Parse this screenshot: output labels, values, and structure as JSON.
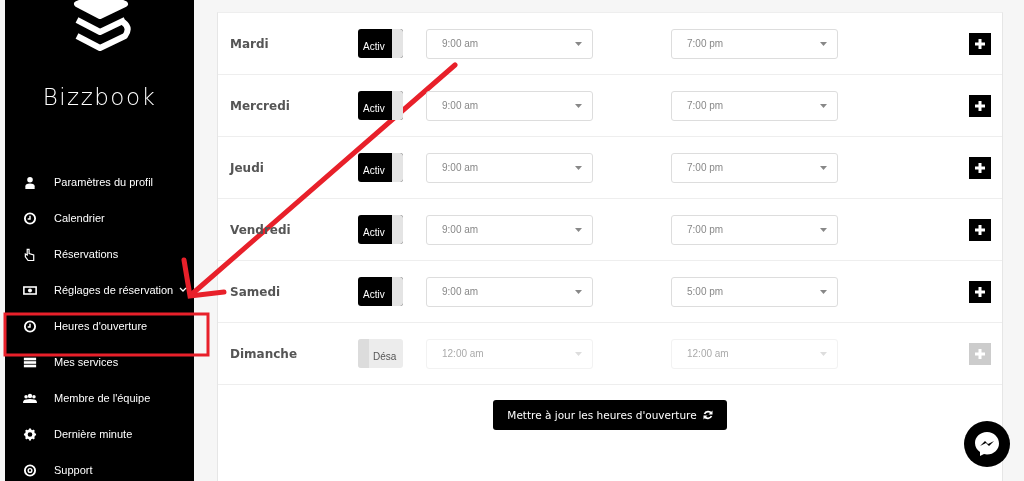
{
  "sidebar": {
    "brand": "Bizzbook",
    "items": [
      {
        "label": "Paramètres du profil",
        "kind": "link"
      },
      {
        "label": "Calendrier",
        "kind": "link"
      },
      {
        "label": "Réservations",
        "kind": "link"
      },
      {
        "label": "Réglages de réservation",
        "kind": "group"
      },
      {
        "label": "Heures d'ouverture",
        "kind": "link"
      },
      {
        "label": "Mes services",
        "kind": "link"
      },
      {
        "label": "Membre de l'équipe",
        "kind": "link"
      },
      {
        "label": "Dernière minute",
        "kind": "link"
      },
      {
        "label": "Support",
        "kind": "link"
      }
    ]
  },
  "schedule": {
    "rows": [
      {
        "day": "Mardi",
        "toggle": "Activ",
        "on": true,
        "open": "9:00 am",
        "close": "7:00 pm"
      },
      {
        "day": "Mercredi",
        "toggle": "Activ",
        "on": true,
        "open": "9:00 am",
        "close": "7:00 pm"
      },
      {
        "day": "Jeudi",
        "toggle": "Activ",
        "on": true,
        "open": "9:00 am",
        "close": "7:00 pm"
      },
      {
        "day": "Vendredi",
        "toggle": "Activ",
        "on": true,
        "open": "9:00 am",
        "close": "7:00 pm"
      },
      {
        "day": "Samedi",
        "toggle": "Activ",
        "on": true,
        "open": "9:00 am",
        "close": "5:00 pm"
      },
      {
        "day": "Dimanche",
        "toggle": "Désa",
        "on": false,
        "open": "12:00 am",
        "close": "12:00 am"
      }
    ],
    "update_button": "Mettre à jour les heures d'ouverture"
  }
}
